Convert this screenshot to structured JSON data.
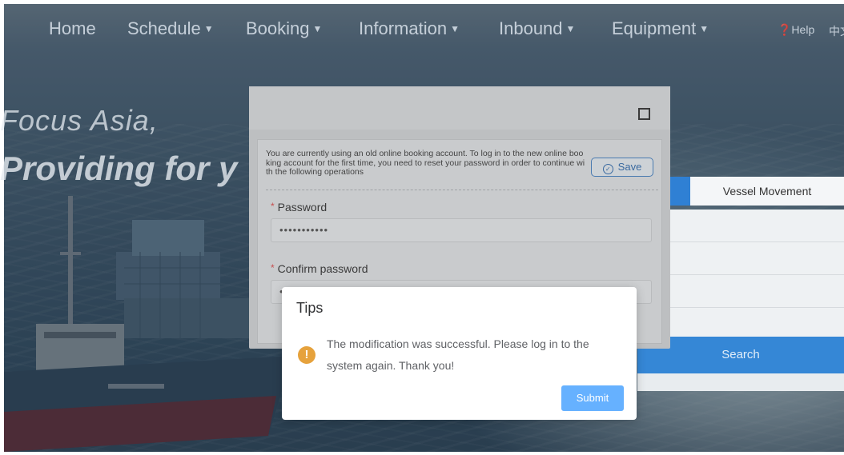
{
  "nav": {
    "items": [
      {
        "label": "Home",
        "has_dropdown": false
      },
      {
        "label": "Schedule",
        "has_dropdown": true
      },
      {
        "label": "Booking",
        "has_dropdown": true
      },
      {
        "label": "Information",
        "has_dropdown": true
      },
      {
        "label": "Inbound",
        "has_dropdown": true
      },
      {
        "label": "Equipment",
        "has_dropdown": true
      }
    ],
    "help_label": "❓Help",
    "language_label": "中文"
  },
  "hero": {
    "slogan_line1": "Focus Asia,",
    "slogan_line2": "Providing for y"
  },
  "side_panel": {
    "tab_label": "Vessel Movement",
    "search_label": "Search"
  },
  "dialog": {
    "notice": "You are currently using an old online booking account. To log in to the new online booking account for the first time, you need to reset your password in order to continue with the following operations",
    "save_label": "Save",
    "password_label": "Password",
    "password_value": "•••••••••••",
    "confirm_label": "Confirm password",
    "confirm_value": "•••••••••••",
    "required_mark": "*"
  },
  "tips": {
    "title": "Tips",
    "icon": "!",
    "message": "The modification was successful. Please log in to the system again. Thank you!",
    "submit_label": "Submit"
  },
  "colors": {
    "primary": "#66b1ff",
    "warning": "#e6a23c",
    "nav_blue": "#3587d6"
  }
}
